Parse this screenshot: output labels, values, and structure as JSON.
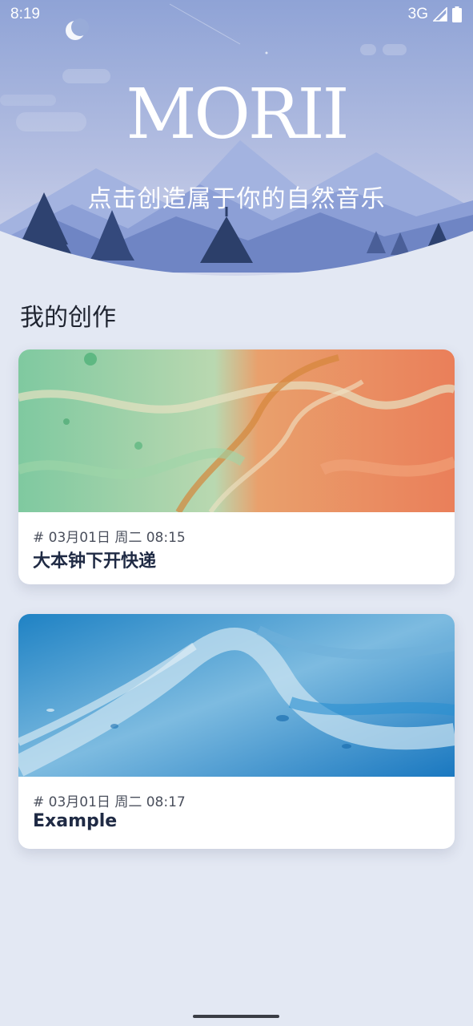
{
  "status_bar": {
    "time": "8:19",
    "network": "3G",
    "signal_icon": "signal-icon",
    "battery_icon": "battery-icon"
  },
  "header": {
    "logo_text": "MORII",
    "tagline": "点击创造属于你的自然音乐",
    "moon_icon": "moon-icon"
  },
  "section": {
    "title": "我的创作"
  },
  "creations": [
    {
      "meta": "# 03月01日 周二 08:15",
      "title": "大本钟下开快递",
      "image": "marble-green-orange"
    },
    {
      "meta": "# 03月01日 周二 08:17",
      "title": "Example",
      "image": "marble-blue"
    }
  ],
  "colors": {
    "sky_top": "#9aacd6",
    "sky_bottom": "#c9d0e8",
    "page_bg": "#e3e8f3",
    "card_title": "#1f2a44"
  }
}
